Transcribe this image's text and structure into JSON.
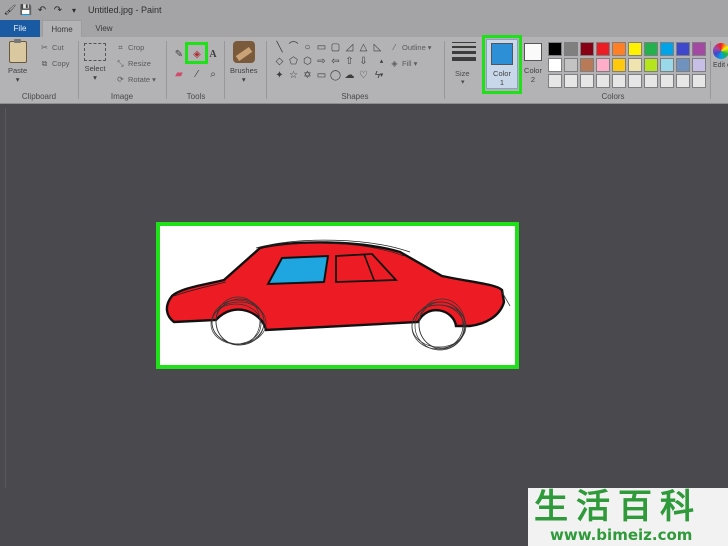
{
  "titlebar": {
    "title": "Untitled.jpg - Paint",
    "quick_access_icons": [
      "paint-app-icon",
      "save-icon",
      "undo-icon",
      "redo-icon",
      "customize-icon"
    ]
  },
  "tabs": [
    {
      "label": "File",
      "active": false
    },
    {
      "label": "Home",
      "active": true
    },
    {
      "label": "View",
      "active": false
    }
  ],
  "clipboard": {
    "paste": "Paste",
    "cut": "Cut",
    "copy": "Copy",
    "label": "Clipboard"
  },
  "image": {
    "select": "Select",
    "crop": "Crop",
    "resize": "Resize",
    "rotate": "Rotate",
    "label": "Image"
  },
  "tools": {
    "label": "Tools",
    "items": [
      "pencil-icon",
      "fill-bucket-icon",
      "text-icon",
      "eraser-icon",
      "color-picker-icon",
      "magnifier-icon"
    ],
    "text_glyph": "A",
    "highlighted": "fill-bucket-icon"
  },
  "brushes": {
    "label": "Brushes"
  },
  "shapes": {
    "label": "Shapes",
    "outline": "Outline",
    "fill": "Fill",
    "glyphs": [
      "\\",
      "⌒",
      "○",
      "▭",
      "▢",
      "△",
      "◺",
      "◇",
      "⬠",
      "⬡",
      "⇨",
      "⇦",
      "⇧",
      "⇩",
      "✦",
      "✧",
      "✶",
      "▭",
      "◯",
      "☁",
      "♡",
      "⚡"
    ]
  },
  "size": {
    "label": "Size"
  },
  "color1": {
    "label": "Color",
    "sub": "1",
    "hex": "#2d8fd6",
    "highlighted": true
  },
  "color2": {
    "label": "Color",
    "sub": "2",
    "hex": "#fafafa"
  },
  "colors": {
    "label": "Colors",
    "edit_label": "Edit colors",
    "palette": [
      "#000000",
      "#7f7f7f",
      "#880015",
      "#ed1c24",
      "#ff7f27",
      "#fff200",
      "#22b14c",
      "#00a2e8",
      "#3f48cc",
      "#a349a4",
      "#ffffff",
      "#c3c3c3",
      "#b97a57",
      "#ffaec9",
      "#ffc90e",
      "#efe4b0",
      "#b5e61d",
      "#99d9ea",
      "#7092be",
      "#c8bfe7",
      "#e6e6e6",
      "#e6e6e6",
      "#e6e6e6",
      "#e6e6e6",
      "#e6e6e6",
      "#e6e6e6",
      "#e6e6e6",
      "#e6e6e6",
      "#e6e6e6",
      "#e6e6e6"
    ]
  },
  "canvas": {
    "image_description": "",
    "car_body_color": "#ed1c24",
    "car_window_color": "#1fa6e0",
    "highlight_color": "#20e01a"
  },
  "watermark": {
    "chars": "生活百科",
    "url": "www.bimeiz.com"
  }
}
